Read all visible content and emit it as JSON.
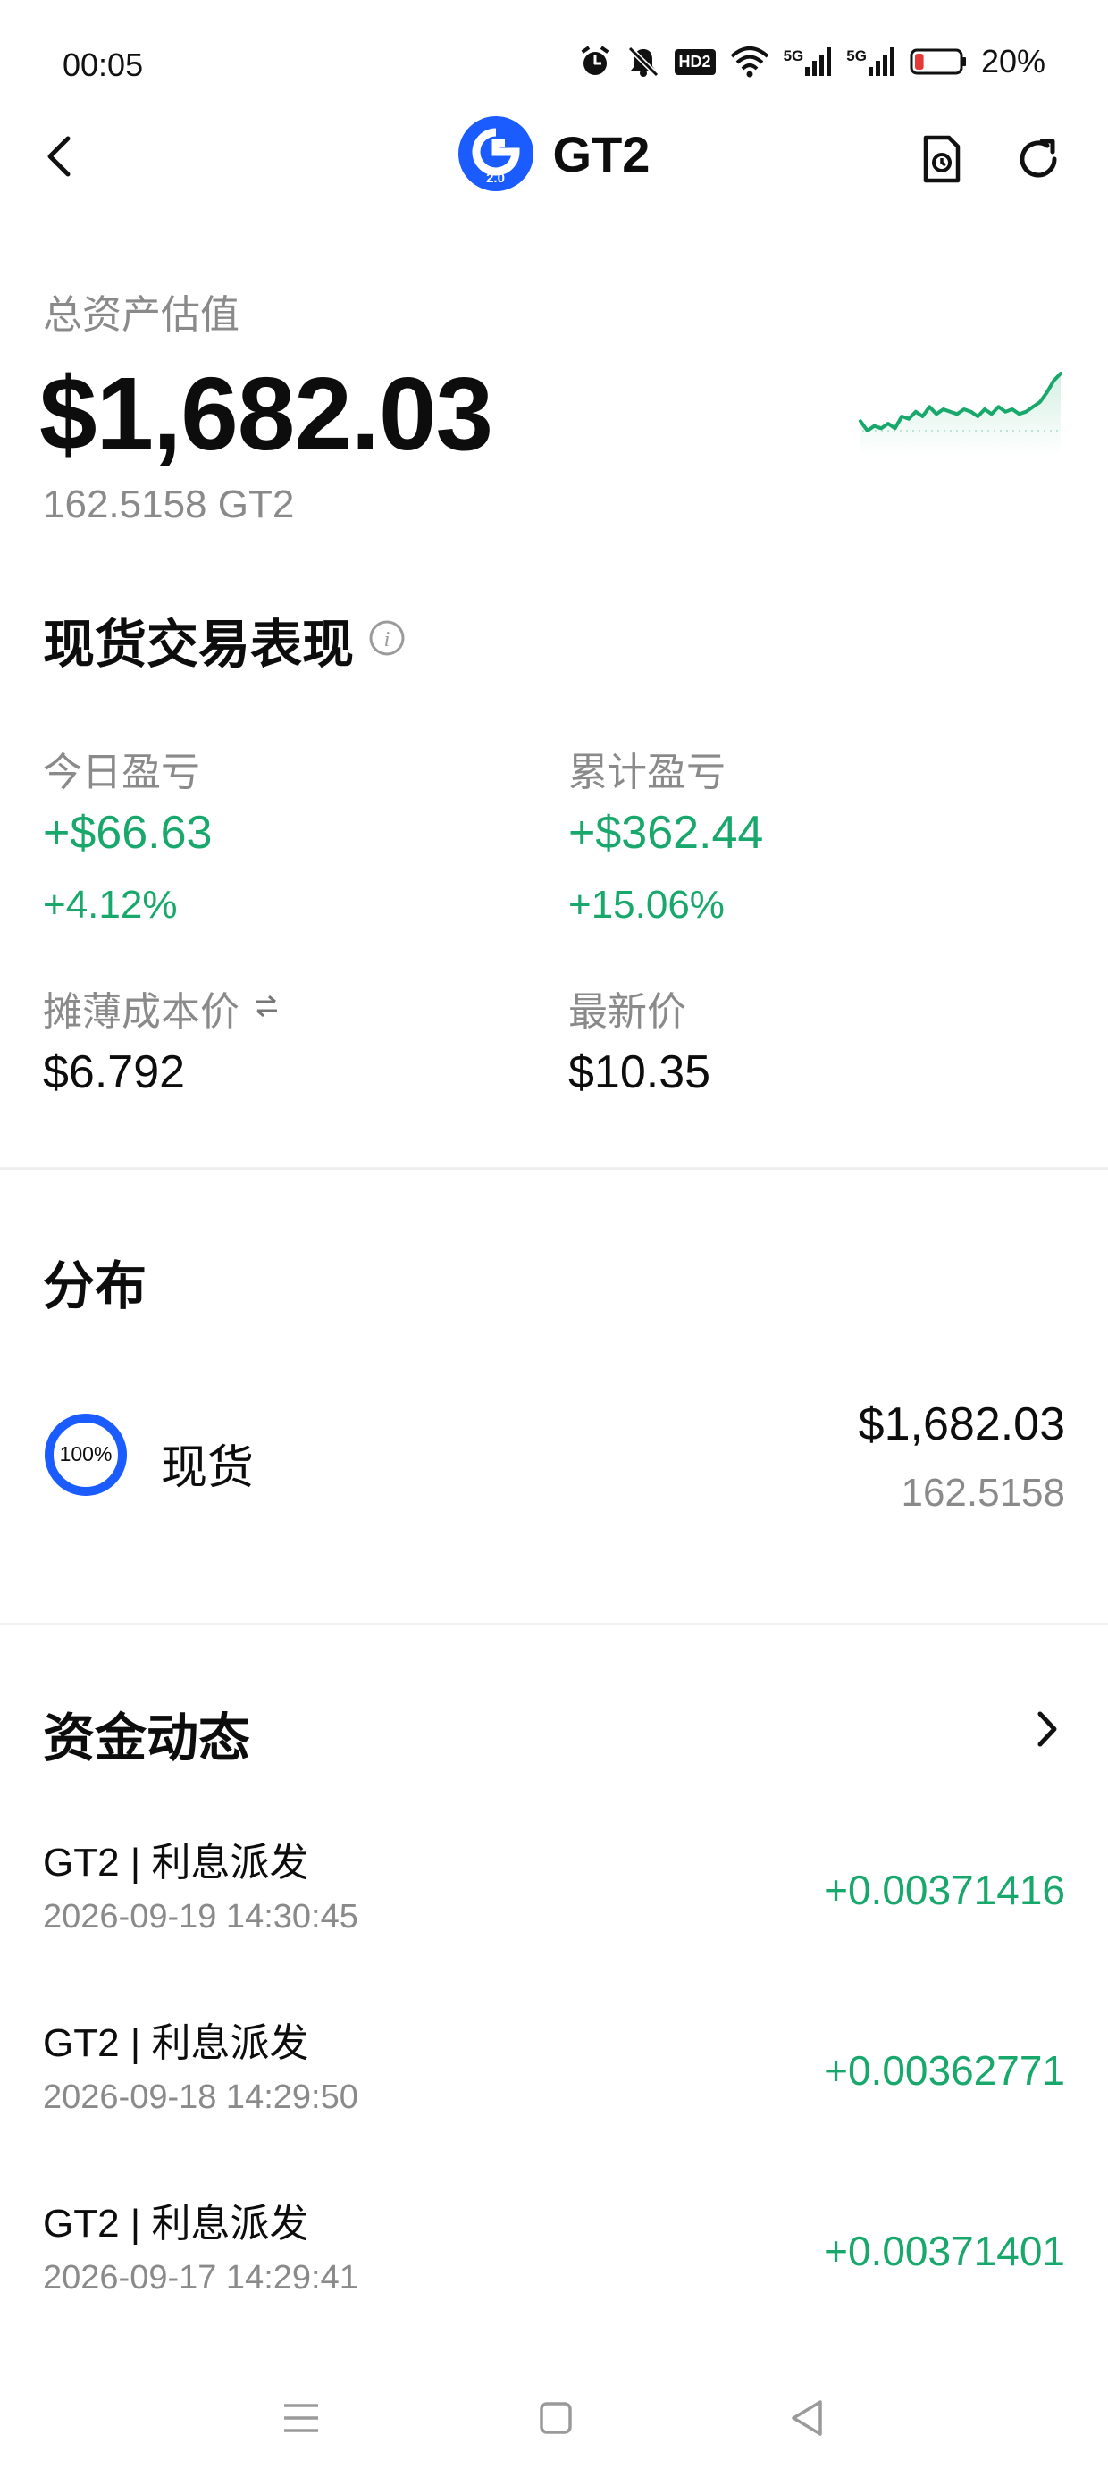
{
  "status_bar": {
    "time": "00:05",
    "battery": "20%",
    "battery_level": 0.2,
    "icons": [
      "alarm-icon",
      "mute-icon",
      "hd-icon",
      "wifi-icon",
      "signal-5g-icon",
      "signal-5g-icon",
      "battery-icon"
    ],
    "hd_label": "HD2",
    "net1": "5G",
    "net2": "5G"
  },
  "header": {
    "title": "GT2",
    "coin_badge": "2.0",
    "icons": [
      "back-icon",
      "history-icon",
      "refresh-icon"
    ]
  },
  "total": {
    "label": "总资产估值",
    "value": "$1,682.03",
    "sub": "162.5158 GT2"
  },
  "sparkline": {
    "color": "#18a86b",
    "values": [
      10,
      6,
      8,
      7,
      9,
      7,
      12,
      11,
      14,
      12,
      16,
      13,
      15,
      14,
      13,
      15,
      14,
      12,
      15,
      13,
      16,
      14,
      15,
      13,
      14,
      16,
      18,
      22,
      27,
      30
    ]
  },
  "performance": {
    "title": "现货交易表现",
    "today_label": "今日盈亏",
    "today_value": "+$66.63",
    "today_pct": "+4.12%",
    "total_label": "累计盈亏",
    "total_value": "+$362.44",
    "total_pct": "+15.06%",
    "cost_label": "摊薄成本价",
    "cost_value": "$6.792",
    "latest_label": "最新价",
    "latest_value": "$10.35"
  },
  "distribution": {
    "title": "分布",
    "ring_pct": "100%",
    "ring_fraction": 1.0,
    "ring_color": "#1a5cff",
    "item_label": "现货",
    "item_value": "$1,682.03",
    "item_amount": "162.5158"
  },
  "activity": {
    "title": "资金动态",
    "rows": [
      {
        "title": "GT2 | 利息派发",
        "date": "2026-09-19 14:30:45",
        "amount": "+0.00371416"
      },
      {
        "title": "GT2 | 利息派发",
        "date": "2026-09-18 14:29:50",
        "amount": "+0.00362771"
      },
      {
        "title": "GT2 | 利息派发",
        "date": "2026-09-17 14:29:41",
        "amount": "+0.00371401"
      }
    ]
  },
  "colors": {
    "accent_green": "#18a86b",
    "brand_blue": "#1a5cff",
    "muted_text": "#8a8a8a"
  }
}
